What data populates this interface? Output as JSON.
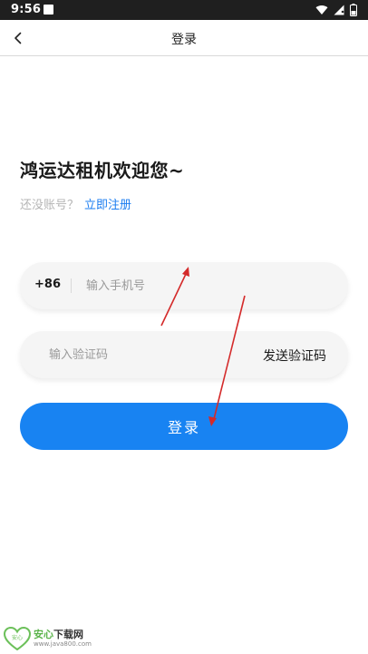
{
  "status_bar": {
    "time": "9:56",
    "icons": [
      "notification-icon",
      "wifi-icon",
      "signal-icon",
      "battery-icon"
    ]
  },
  "nav": {
    "title": "登录",
    "back_icon": "chevron-left-icon"
  },
  "welcome": {
    "title": "鸿运达租机欢迎您~",
    "no_account": "还没账号？",
    "register": "立即注册"
  },
  "phone_field": {
    "country_code": "+86",
    "placeholder": "输入手机号",
    "value": ""
  },
  "code_field": {
    "placeholder": "输入验证码",
    "value": "",
    "send_label": "发送验证码"
  },
  "login_button": {
    "label": "登录"
  },
  "watermark": {
    "logo_text": "安心",
    "name_part1": "安心",
    "name_part2": "下载网",
    "url": "www.java800.com"
  },
  "colors": {
    "primary": "#1883f2",
    "link": "#1a7cf0",
    "annotation_arrow": "#d42a2a",
    "status_bar": "#1f1f1f"
  }
}
